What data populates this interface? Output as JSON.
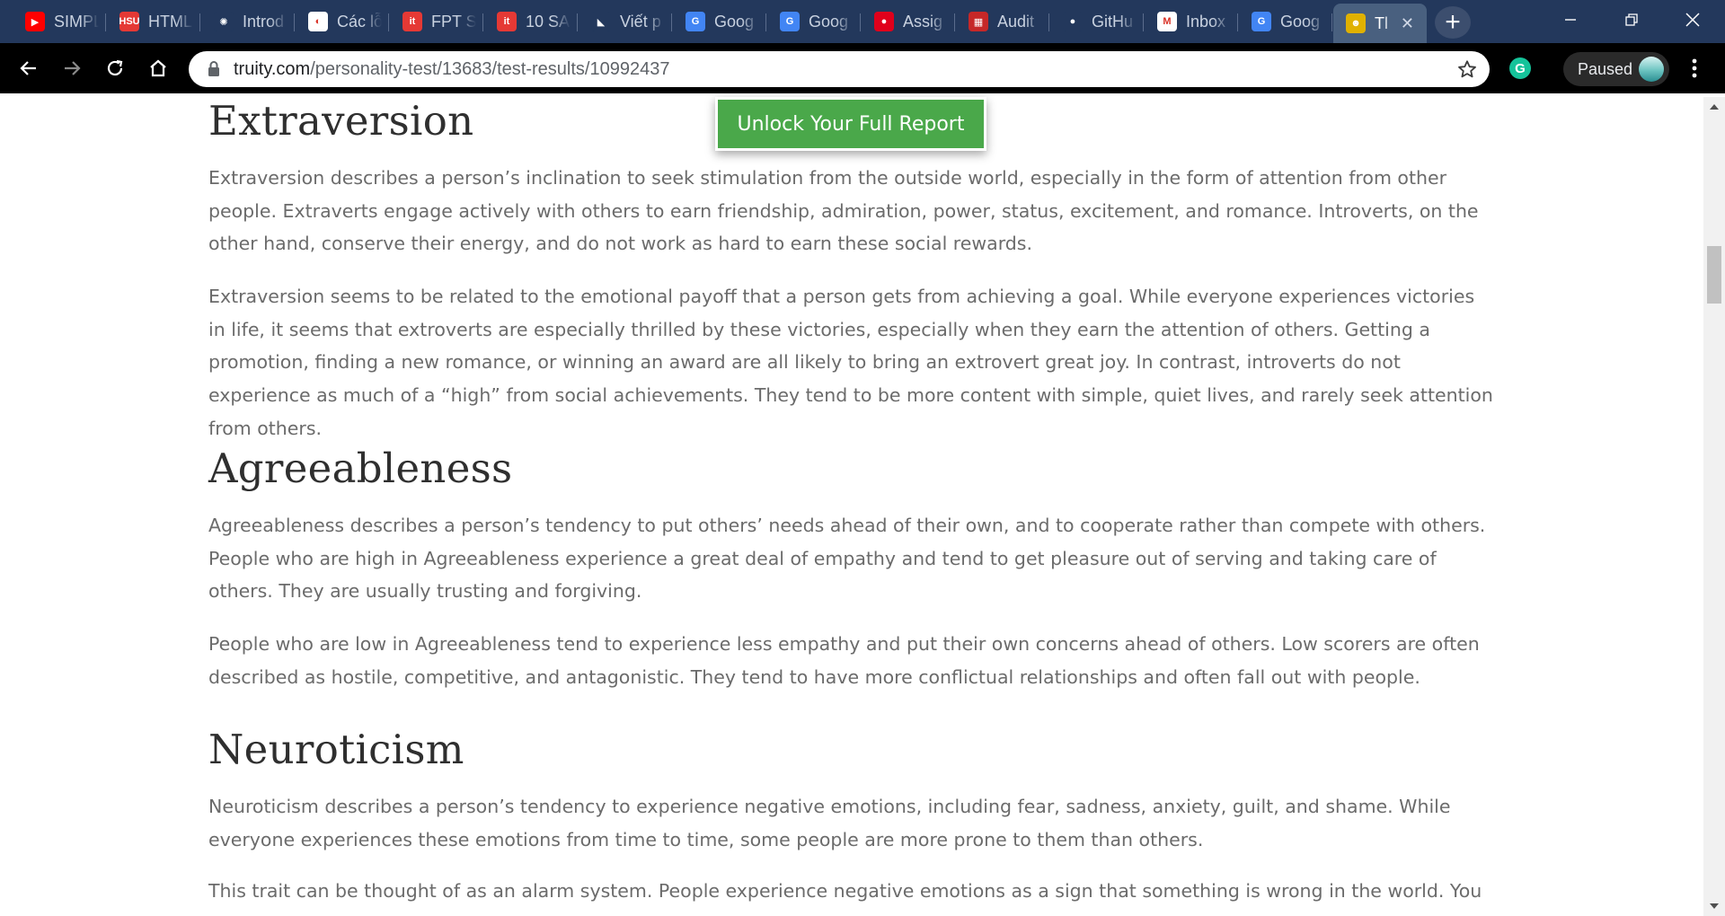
{
  "browser": {
    "tabs": [
      {
        "title": "SIMPL",
        "favicon": "youtube-icon",
        "favicon_color": "#ff0000",
        "favicon_glyph": "▶"
      },
      {
        "title": "HTML",
        "favicon": "hsu-icon",
        "favicon_color": "#e53935",
        "favicon_glyph": "HSU"
      },
      {
        "title": "Introd",
        "favicon": "spark-icon",
        "favicon_color": "#23385c",
        "favicon_glyph": "✺"
      },
      {
        "title": "Các lỗ",
        "favicon": "chrome-colored-icon",
        "favicon_color": "#ffffff",
        "favicon_glyph": "◐"
      },
      {
        "title": "FPT S",
        "favicon": "it-icon",
        "favicon_color": "#e53935",
        "favicon_glyph": "it"
      },
      {
        "title": "10 SA",
        "favicon": "it-icon",
        "favicon_color": "#e53935",
        "favicon_glyph": "it"
      },
      {
        "title": "Viết p",
        "favicon": "cursor-icon",
        "favicon_color": "#23385c",
        "favicon_glyph": "◣"
      },
      {
        "title": "Goog",
        "favicon": "google-translate-icon",
        "favicon_color": "#4285f4",
        "favicon_glyph": "G"
      },
      {
        "title": "Goog",
        "favicon": "google-translate-icon",
        "favicon_color": "#4285f4",
        "favicon_glyph": "G"
      },
      {
        "title": "Assig",
        "favicon": "assignment-icon",
        "favicon_color": "#e0001b",
        "favicon_glyph": "●"
      },
      {
        "title": "Audit",
        "favicon": "audit-icon",
        "favicon_color": "#c62828",
        "favicon_glyph": "▦"
      },
      {
        "title": "GitHu",
        "favicon": "github-icon",
        "favicon_color": "#23385c",
        "favicon_glyph": "●"
      },
      {
        "title": "Inbox",
        "favicon": "gmail-icon",
        "favicon_color": "#ffffff",
        "favicon_glyph": "M"
      },
      {
        "title": "Goog",
        "favicon": "google-translate-icon",
        "favicon_color": "#4285f4",
        "favicon_glyph": "G"
      },
      {
        "title": "Tl",
        "favicon": "truity-icon",
        "favicon_color": "#e0b100",
        "favicon_glyph": "☻",
        "active": true
      }
    ],
    "url": {
      "host": "truity.com",
      "path": "/personality-test/13683/test-results/10992437"
    },
    "profile_label": "Paused",
    "extension_label": "G"
  },
  "page": {
    "cta_label": "Unlock Your Full Report",
    "sections": [
      {
        "heading": "Extraversion",
        "paragraphs": [
          "Extraversion describes a person’s inclination to seek stimulation from the outside world, especially in the form of attention from other people. Extraverts engage actively with others to earn friendship, admiration, power, status, excitement, and romance. Introverts, on the other hand, conserve their energy, and do not work as hard to earn these social rewards.",
          "Extraversion seems to be related to the emotional payoff that a person gets from achieving a goal. While everyone experiences victories in life, it seems that extroverts are especially thrilled by these victories, especially when they earn the attention of others. Getting a promotion, finding a new romance, or winning an award are all likely to bring an extrovert great joy. In contrast, introverts do not experience as much of a “high” from social achievements. They tend to be more content with simple, quiet lives, and rarely seek attention from others."
        ]
      },
      {
        "heading": "Agreeableness",
        "paragraphs": [
          "Agreeableness describes a person’s tendency to put others’ needs ahead of their own, and to cooperate rather than compete with others. People who are high in Agreeableness experience a great deal of empathy and tend to get pleasure out of serving and taking care of others. They are usually trusting and forgiving.",
          "People who are low in Agreeableness tend to experience less empathy and put their own concerns ahead of others. Low scorers are often described as hostile, competitive, and antagonistic. They tend to have more conflictual relationships and often fall out with people."
        ]
      },
      {
        "heading": "Neuroticism",
        "paragraphs": [
          "Neuroticism describes a person’s tendency to experience negative emotions, including fear, sadness, anxiety, guilt, and shame. While everyone experiences these emotions from time to time, some people are more prone to them than others.",
          "This trait can be thought of as an alarm system. People experience negative emotions as a sign that something is wrong in the world. You may be"
        ]
      }
    ]
  }
}
